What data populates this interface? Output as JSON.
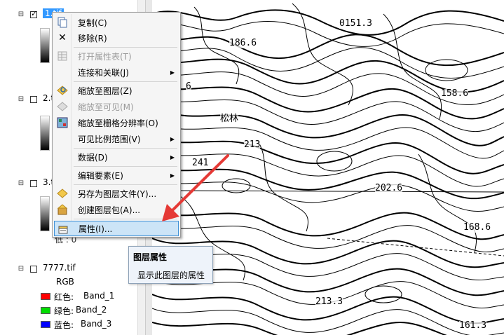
{
  "toc": {
    "layers": [
      {
        "name": "1.tif",
        "checked": true,
        "selected": true
      },
      {
        "name": "2.t",
        "checked": false,
        "selected": false
      },
      {
        "name": "3.t",
        "checked": false,
        "selected": false
      },
      {
        "name": "7777.tif",
        "checked": false,
        "selected": false
      }
    ],
    "partial_value": "低 : 0",
    "rgb_label": "RGB",
    "bands": [
      {
        "label": "红色:",
        "value": "Band_1",
        "color": "#ff0000"
      },
      {
        "label": "绿色:",
        "value": "Band_2",
        "color": "#00dd00"
      },
      {
        "label": "蓝色:",
        "value": "Band_3",
        "color": "#0000ff"
      }
    ]
  },
  "context_menu": {
    "items": [
      {
        "label": "复制(C)",
        "icon": "copy-icon",
        "enabled": true,
        "submenu": false
      },
      {
        "label": "移除(R)",
        "icon": "remove-icon",
        "enabled": true,
        "submenu": false
      },
      {
        "label": "打开属性表(T)",
        "icon": "table-icon",
        "enabled": false,
        "submenu": false
      },
      {
        "label": "连接和关联(J)",
        "icon": "",
        "enabled": true,
        "submenu": true
      },
      {
        "label": "缩放至图层(Z)",
        "icon": "zoom-to-layer-icon",
        "enabled": true,
        "submenu": false
      },
      {
        "label": "缩放至可见(M)",
        "icon": "zoom-to-visible-icon",
        "enabled": false,
        "submenu": false
      },
      {
        "label": "缩放至栅格分辨率(O)",
        "icon": "zoom-raster-resolution-icon",
        "enabled": true,
        "submenu": false
      },
      {
        "label": "可见比例范围(V)",
        "icon": "",
        "enabled": true,
        "submenu": true
      },
      {
        "label": "数据(D)",
        "icon": "",
        "enabled": true,
        "submenu": true
      },
      {
        "label": "编辑要素(E)",
        "icon": "",
        "enabled": true,
        "submenu": true
      },
      {
        "label": "另存为图层文件(Y)...",
        "icon": "save-layer-file-icon",
        "enabled": true,
        "submenu": false
      },
      {
        "label": "创建图层包(A)...",
        "icon": "layer-package-icon",
        "enabled": true,
        "submenu": false
      },
      {
        "label": "属性(I)...",
        "icon": "properties-icon",
        "enabled": true,
        "submenu": false,
        "highlighted": true
      }
    ]
  },
  "tooltip": {
    "title": "图层属性",
    "description": "显示此图层的属性"
  },
  "map": {
    "elevation_labels": [
      "0151.3",
      "186.6",
      "158.6",
      "6",
      "213",
      "241",
      "202.6",
      "168.6",
      "213.3",
      "161.3"
    ],
    "place_label": "松林"
  },
  "colors": {
    "selection": "#3399ff",
    "menu_highlight": "#cce4f7",
    "annotation_arrow": "#e53935"
  }
}
